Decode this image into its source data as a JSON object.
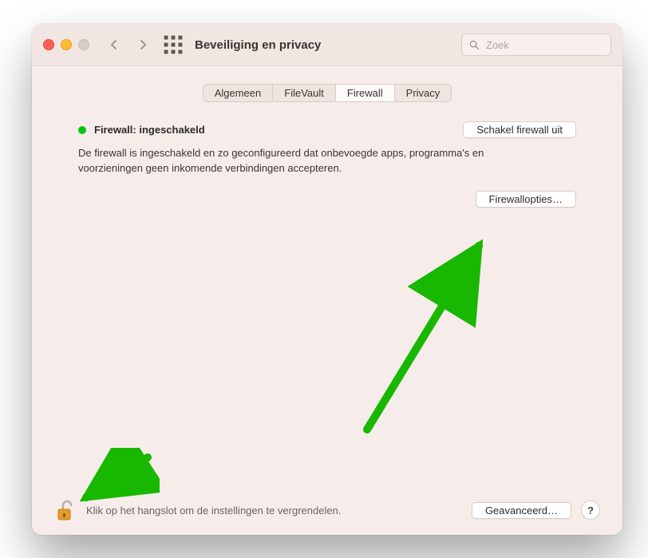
{
  "window": {
    "title": "Beveiliging en privacy"
  },
  "search": {
    "placeholder": "Zoek",
    "value": ""
  },
  "tabs": {
    "items": [
      {
        "label": "Algemeen"
      },
      {
        "label": "FileVault"
      },
      {
        "label": "Firewall"
      },
      {
        "label": "Privacy"
      }
    ],
    "active_index": 2
  },
  "firewall": {
    "status_label": "Firewall: ingeschakeld",
    "status_color": "#00c315",
    "toggle_button": "Schakel firewall uit",
    "description": "De firewall is ingeschakeld en zo geconfigureerd dat onbevoegde apps, programma's en voorzieningen geen inkomende verbindingen accepteren.",
    "options_button": "Firewallopties…"
  },
  "footer": {
    "lock_text": "Klik op het hangslot om de instellingen te vergrendelen.",
    "advanced_button": "Geavanceerd…",
    "help_label": "?"
  },
  "annotation": {
    "arrow_color": "#18b700"
  }
}
